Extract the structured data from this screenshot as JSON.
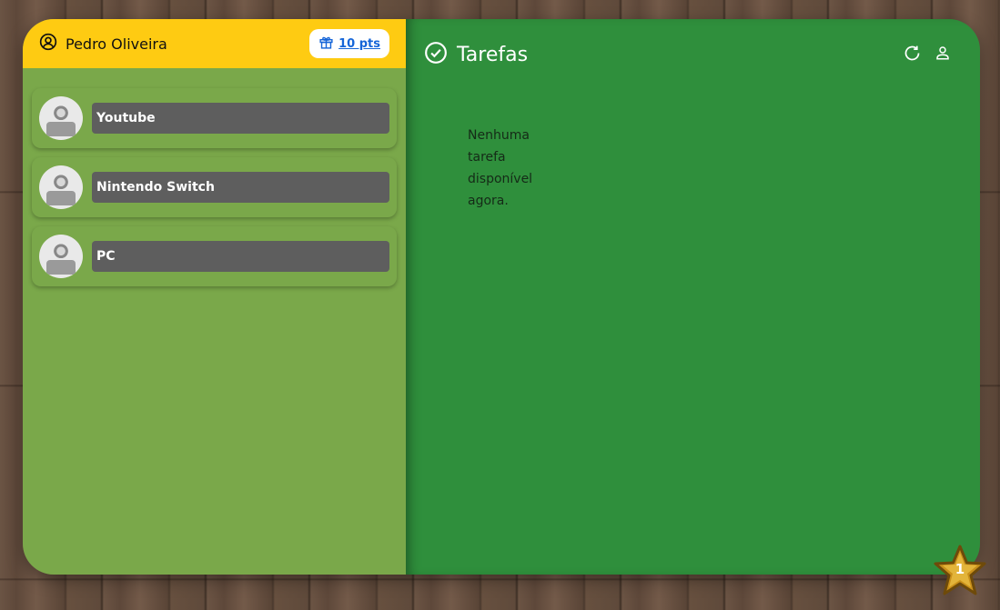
{
  "header": {
    "user_name": "Pedro Oliveira",
    "points_label": "10 pts"
  },
  "rewards": [
    {
      "label": "Youtube"
    },
    {
      "label": "Nintendo Switch"
    },
    {
      "label": "PC"
    }
  ],
  "tasks": {
    "title": "Tarefas",
    "empty_message": "Nenhuma tarefa disponível agora."
  },
  "star_badge": {
    "count": "1"
  },
  "icons": {
    "user": "user-circle-icon",
    "gift": "gift-icon",
    "check": "check-circle-icon",
    "refresh": "refresh-icon",
    "profile": "person-icon",
    "star": "star-icon"
  },
  "colors": {
    "left_panel": "#7aa84a",
    "header_yellow": "#fecb12",
    "right_panel": "#2f8f3c",
    "item_label_bg": "#5e5e5e",
    "link_blue": "#1565d8"
  }
}
